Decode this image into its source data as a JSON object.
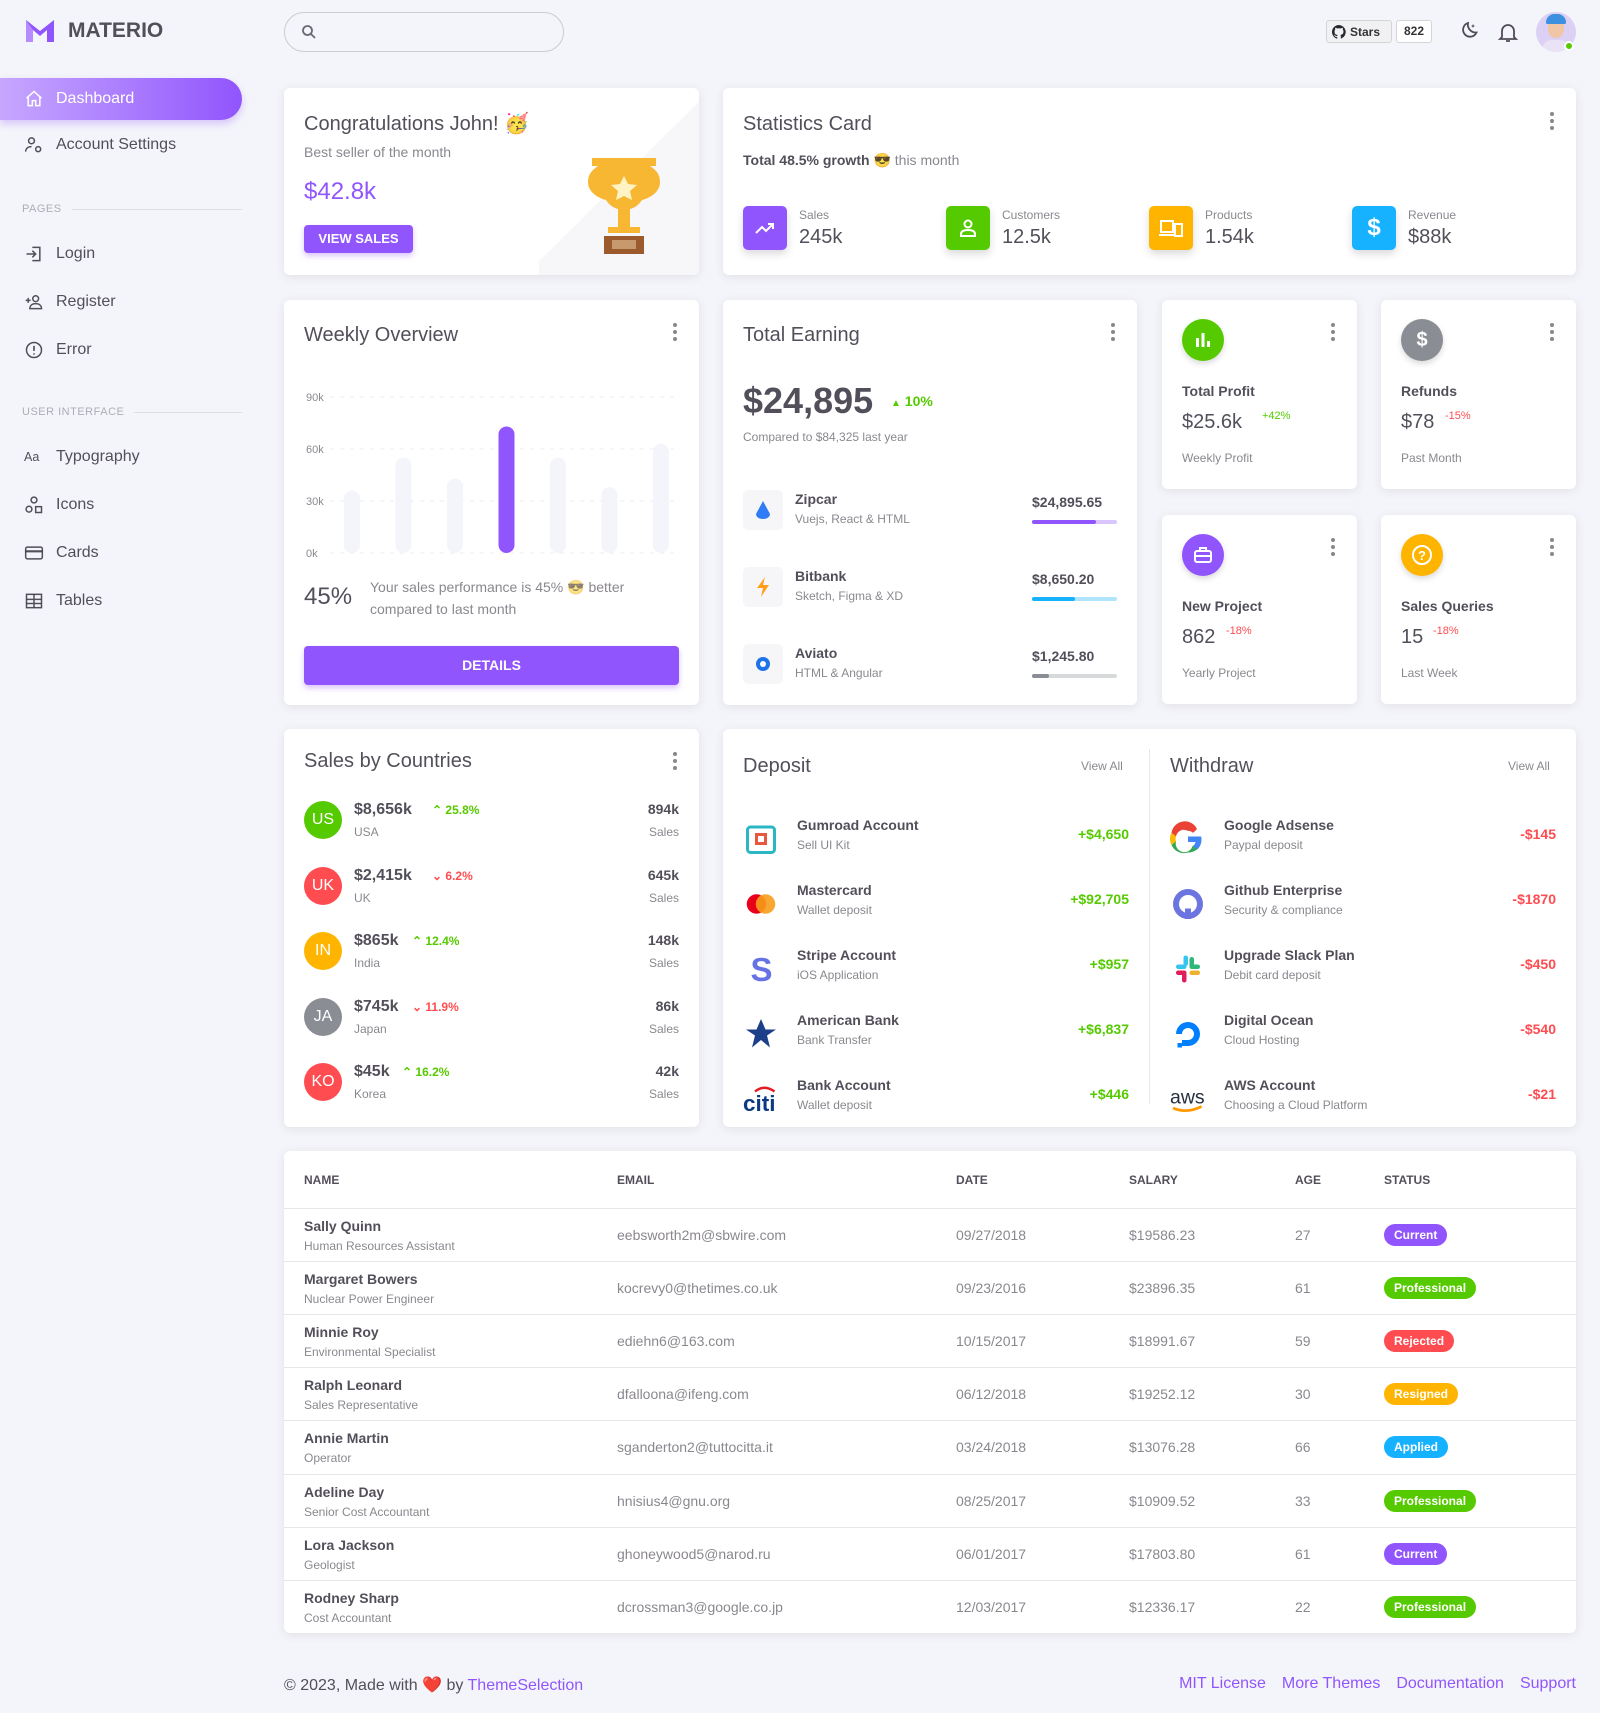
{
  "brand": {
    "name": "MATERIO",
    "color": "#9155FD"
  },
  "topbar": {
    "search_placeholder": "",
    "github_stars_label": "Stars",
    "github_stars_count": "822",
    "icons": [
      "search-icon",
      "github-icon",
      "moon-icon",
      "bell-icon",
      "avatar"
    ]
  },
  "sidebar": {
    "items": [
      {
        "label": "Dashboard",
        "icon": "home-icon",
        "active": true
      },
      {
        "label": "Account Settings",
        "icon": "account-cog-icon"
      }
    ],
    "pages_header": "PAGES",
    "pages": [
      {
        "label": "Login",
        "icon": "login-icon"
      },
      {
        "label": "Register",
        "icon": "account-plus-icon"
      },
      {
        "label": "Error",
        "icon": "alert-circle-icon"
      }
    ],
    "ui_header": "USER INTERFACE",
    "ui": [
      {
        "label": "Typography",
        "icon": "typography-icon"
      },
      {
        "label": "Icons",
        "icon": "shapes-icon"
      },
      {
        "label": "Cards",
        "icon": "credit-card-icon"
      },
      {
        "label": "Tables",
        "icon": "table-icon"
      }
    ]
  },
  "congrats": {
    "title": "Congratulations John! 🥳",
    "subtitle": "Best seller of the month",
    "amount": "$42.8k",
    "button": "VIEW SALES"
  },
  "statistics": {
    "title": "Statistics Card",
    "growth_bold": "Total 48.5% growth",
    "growth_emoji": "😎",
    "growth_rest": "this month",
    "items": [
      {
        "label": "Sales",
        "value": "245k",
        "color": "#9155FD",
        "icon": "trending-up-icon"
      },
      {
        "label": "Customers",
        "value": "12.5k",
        "color": "#56CA00",
        "icon": "account-icon"
      },
      {
        "label": "Products",
        "value": "1.54k",
        "color": "#FFB400",
        "icon": "cellphone-link-icon"
      },
      {
        "label": "Revenue",
        "value": "$88k",
        "color": "#16B1FF",
        "icon": "currency-usd-icon"
      }
    ]
  },
  "weekly": {
    "title": "Weekly Overview",
    "percent": "45%",
    "text": "Your sales performance is 45% 😎 better compared to last month",
    "button": "DETAILS",
    "chart_data": {
      "type": "bar",
      "ylim": [
        0,
        90
      ],
      "yticks": [
        "0k",
        "30k",
        "60k",
        "90k"
      ],
      "values": [
        36,
        55,
        43,
        73,
        55,
        38,
        63
      ],
      "highlight_index": 3,
      "highlight_color": "#9155FD",
      "bar_color": "#F4F5FA",
      "grid": true
    }
  },
  "earning": {
    "title": "Total Earning",
    "amount": "$24,895",
    "change": "10%",
    "compare": "Compared to $84,325 last year",
    "items": [
      {
        "name": "Zipcar",
        "desc": "Vuejs, React & HTML",
        "amount": "$24,895.65",
        "progress": 75,
        "color": "#9155FD",
        "icon": "zipcar-logo"
      },
      {
        "name": "Bitbank",
        "desc": "Sketch, Figma & XD",
        "amount": "$8,650.20",
        "progress": 50,
        "color": "#16B1FF",
        "icon": "bitbank-logo"
      },
      {
        "name": "Aviato",
        "desc": "HTML & Angular",
        "amount": "$1,245.80",
        "progress": 20,
        "color": "#8A8D93",
        "icon": "aviato-logo"
      }
    ]
  },
  "mini_cards": [
    {
      "title": "Total Profit",
      "value": "$25.6k",
      "change": "+42%",
      "positive": true,
      "subtitle": "Weekly Profit",
      "color": "#56CA00",
      "icon": "poll-icon"
    },
    {
      "title": "Refunds",
      "value": "$78",
      "change": "-15%",
      "positive": false,
      "subtitle": "Past Month",
      "color": "#8A8D93",
      "icon": "currency-usd-icon"
    },
    {
      "title": "New Project",
      "value": "862",
      "change": "-18%",
      "positive": false,
      "subtitle": "Yearly Project",
      "color": "#9155FD",
      "icon": "briefcase-icon"
    },
    {
      "title": "Sales Queries",
      "value": "15",
      "change": "-18%",
      "positive": false,
      "subtitle": "Last Week",
      "color": "#FFB400",
      "icon": "help-circle-icon"
    }
  ],
  "countries": {
    "title": "Sales by Countries",
    "items": [
      {
        "code": "US",
        "amount": "$8,656k",
        "change": "25.8%",
        "up": true,
        "country": "USA",
        "sales": "894k",
        "sales_label": "Sales",
        "color": "#56CA00"
      },
      {
        "code": "UK",
        "amount": "$2,415k",
        "change": "6.2%",
        "up": false,
        "country": "UK",
        "sales": "645k",
        "sales_label": "Sales",
        "color": "#FF4C51"
      },
      {
        "code": "IN",
        "amount": "$865k",
        "change": "12.4%",
        "up": true,
        "country": "India",
        "sales": "148k",
        "sales_label": "Sales",
        "color": "#FFB400"
      },
      {
        "code": "JA",
        "amount": "$745k",
        "change": "11.9%",
        "up": false,
        "country": "Japan",
        "sales": "86k",
        "sales_label": "Sales",
        "color": "#8A8D93"
      },
      {
        "code": "KO",
        "amount": "$45k",
        "change": "16.2%",
        "up": true,
        "country": "Korea",
        "sales": "42k",
        "sales_label": "Sales",
        "color": "#FF4C51"
      }
    ]
  },
  "deposit": {
    "title": "Deposit",
    "view_all": "View All",
    "items": [
      {
        "name": "Gumroad Account",
        "desc": "Sell UI Kit",
        "amount": "+$4,650",
        "icon": "gumroad-logo"
      },
      {
        "name": "Mastercard",
        "desc": "Wallet deposit",
        "amount": "+$92,705",
        "icon": "mastercard-logo"
      },
      {
        "name": "Stripe Account",
        "desc": "iOS Application",
        "amount": "+$957",
        "icon": "stripe-logo"
      },
      {
        "name": "American Bank",
        "desc": "Bank Transfer",
        "amount": "+$6,837",
        "icon": "american-bank-logo"
      },
      {
        "name": "Bank Account",
        "desc": "Wallet deposit",
        "amount": "+$446",
        "icon": "citi-logo"
      }
    ]
  },
  "withdraw": {
    "title": "Withdraw",
    "view_all": "View All",
    "items": [
      {
        "name": "Google Adsense",
        "desc": "Paypal deposit",
        "amount": "-$145",
        "icon": "google-logo"
      },
      {
        "name": "Github Enterprise",
        "desc": "Security & compliance",
        "amount": "-$1870",
        "icon": "github-logo"
      },
      {
        "name": "Upgrade Slack Plan",
        "desc": "Debit card deposit",
        "amount": "-$450",
        "icon": "slack-logo"
      },
      {
        "name": "Digital Ocean",
        "desc": "Cloud Hosting",
        "amount": "-$540",
        "icon": "digital-ocean-logo"
      },
      {
        "name": "AWS Account",
        "desc": "Choosing a Cloud Platform",
        "amount": "-$21",
        "icon": "aws-logo"
      }
    ]
  },
  "table": {
    "columns": [
      "NAME",
      "EMAIL",
      "DATE",
      "SALARY",
      "AGE",
      "STATUS"
    ],
    "status_colors": {
      "Current": "#9155FD",
      "Professional": "#56CA00",
      "Rejected": "#FF4C51",
      "Resigned": "#FFB400",
      "Applied": "#16B1FF"
    },
    "rows": [
      {
        "name": "Sally Quinn",
        "designation": "Human Resources Assistant",
        "email": "eebsworth2m@sbwire.com",
        "date": "09/27/2018",
        "salary": "$19586.23",
        "age": "27",
        "status": "Current"
      },
      {
        "name": "Margaret Bowers",
        "designation": "Nuclear Power Engineer",
        "email": "kocrevy0@thetimes.co.uk",
        "date": "09/23/2016",
        "salary": "$23896.35",
        "age": "61",
        "status": "Professional"
      },
      {
        "name": "Minnie Roy",
        "designation": "Environmental Specialist",
        "email": "ediehn6@163.com",
        "date": "10/15/2017",
        "salary": "$18991.67",
        "age": "59",
        "status": "Rejected"
      },
      {
        "name": "Ralph Leonard",
        "designation": "Sales Representative",
        "email": "dfalloona@ifeng.com",
        "date": "06/12/2018",
        "salary": "$19252.12",
        "age": "30",
        "status": "Resigned"
      },
      {
        "name": "Annie Martin",
        "designation": "Operator",
        "email": "sganderton2@tuttocitta.it",
        "date": "03/24/2018",
        "salary": "$13076.28",
        "age": "66",
        "status": "Applied"
      },
      {
        "name": "Adeline Day",
        "designation": "Senior Cost Accountant",
        "email": "hnisius4@gnu.org",
        "date": "08/25/2017",
        "salary": "$10909.52",
        "age": "33",
        "status": "Professional"
      },
      {
        "name": "Lora Jackson",
        "designation": "Geologist",
        "email": "ghoneywood5@narod.ru",
        "date": "06/01/2017",
        "salary": "$17803.80",
        "age": "61",
        "status": "Current"
      },
      {
        "name": "Rodney Sharp",
        "designation": "Cost Accountant",
        "email": "dcrossman3@google.co.jp",
        "date": "12/03/2017",
        "salary": "$12336.17",
        "age": "22",
        "status": "Professional"
      }
    ]
  },
  "footer": {
    "copyright_pre": "© 2023, Made with",
    "heart": "❤️",
    "by": "by",
    "author": "ThemeSelection",
    "links": [
      "MIT License",
      "More Themes",
      "Documentation",
      "Support"
    ]
  }
}
